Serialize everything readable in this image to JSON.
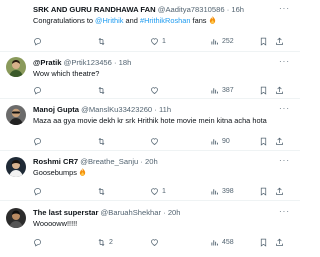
{
  "tweets": [
    {
      "name": "SRK AND GURU RANDHAWA FAN",
      "handle": "@Aaditya78310586",
      "time": "16h",
      "text_prefix": "Congratulations to ",
      "mention1": "@Hrithik",
      "text_mid": " and ",
      "mention2": "#HrithikRoshan",
      "text_suffix": " fans",
      "likes": "1",
      "views": "252"
    },
    {
      "name": "@Pratik",
      "handle": "@Prtik123456",
      "time": "18h",
      "text": "Wow which theatre?",
      "views": "387"
    },
    {
      "name": "Manoj Gupta",
      "handle": "@ManslKu33423260",
      "time": "11h",
      "text_line1": "Maza aa gya movie dekh kr srk Hrithik hote movie mein kitna acha hota",
      "views": "90"
    },
    {
      "name": "Roshmi CR7",
      "handle": "@Breathe_Sanju",
      "time": "20h",
      "text": "Goosebumps",
      "likes": "1",
      "views": "398"
    },
    {
      "name": "The last superstar",
      "handle": "@BaruahShekhar",
      "time": "20h",
      "text": "Wooooww!!!!!",
      "retweets": "2",
      "views": "458"
    }
  ],
  "colors": {
    "accent": "#1d9bf0",
    "muted": "#536471",
    "text": "#0f1419",
    "fire": "#f4900c"
  }
}
